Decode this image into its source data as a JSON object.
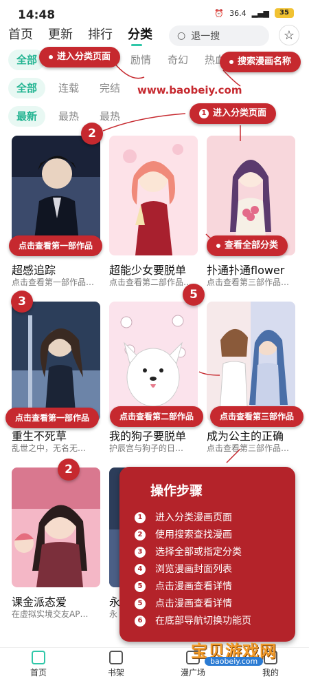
{
  "status": {
    "time": "14:48",
    "signal": "36.4",
    "battery": "35"
  },
  "topnav": {
    "tabs": [
      "首页",
      "更新",
      "排行",
      "分类"
    ],
    "search_placeholder": "退一搜"
  },
  "filters": {
    "row1": [
      "全部",
      "励情",
      "奇幻",
      "热血"
    ],
    "row2": [
      "全部",
      "连载",
      "完结"
    ],
    "row3": [
      "最新",
      "最热",
      "最热"
    ]
  },
  "cards": [
    {
      "title": "超感追踪",
      "desc": "点击查看第一部作品…",
      "colors": [
        "#1a2238",
        "#3b4a6b"
      ]
    },
    {
      "title": "超能少女要脱单",
      "desc": "点击查看第二部作品…",
      "colors": [
        "#fde2e8",
        "#f5b5c4"
      ]
    },
    {
      "title": "扑通扑通flower",
      "desc": "点击查看第三部作品…",
      "colors": [
        "#f8d7dc",
        "#f2bcc6"
      ]
    },
    {
      "title": "重生不死草",
      "desc": "乱世之中，无名无…",
      "colors": [
        "#2c3e5a",
        "#6c84a8"
      ]
    },
    {
      "title": "我的狗子要脱单",
      "desc": "护辰宫与狗子的日…",
      "colors": [
        "#fbe3ec",
        "#f7cbdc"
      ]
    },
    {
      "title": "成为公主的正确",
      "desc": "点击查看第三部作品…",
      "colors": [
        "#f6e9ea",
        "#d7dcef"
      ]
    },
    {
      "title": "课金派态爱",
      "desc": "在虚拟实境交友AP…",
      "colors": [
        "#f4b7c6",
        "#7b2f3b"
      ]
    },
    {
      "title": "永",
      "desc": "永",
      "colors": [
        "#2d3d5a",
        "#4b5f86"
      ]
    }
  ],
  "annotations": {
    "pill_enter": "进入分类页面",
    "pill_search": "搜索漫画名称",
    "pill_enter2": "进入分类页面",
    "url": "www.baobeiy.com",
    "pill_view_all": "查看全部分类",
    "card_pill_1": "点击查看第一部作品",
    "card_pill_r2_1": "点击查看第一部作品",
    "card_pill_r2_2": "点击查看第二部作品",
    "card_pill_r2_3": "点击查看第三部作品",
    "badge_a": "2",
    "badge_b": "3",
    "badge_c": "5",
    "badge_d": "2",
    "num_1": "1"
  },
  "steps": {
    "title": "操作步骤",
    "items": [
      {
        "n": "1",
        "text": "进入分类漫画页面"
      },
      {
        "n": "2",
        "text": "使用搜索查找漫画"
      },
      {
        "n": "3",
        "text": "选择全部或指定分类"
      },
      {
        "n": "4",
        "text": "浏览漫画封面列表"
      },
      {
        "n": "5",
        "text": "点击漫画查看详情"
      },
      {
        "n": "5",
        "text": "点击漫画查看详情"
      },
      {
        "n": "6",
        "text": "在底部导航切换功能页"
      }
    ]
  },
  "bottomnav": {
    "items": [
      "首页",
      "书架",
      "漫广场",
      "我的"
    ]
  },
  "watermark": {
    "name": "宝贝游戏网",
    "url": "baobeiy.com"
  },
  "colors": {
    "accent": "#2fc7a8",
    "annotation": "#c6292f"
  }
}
